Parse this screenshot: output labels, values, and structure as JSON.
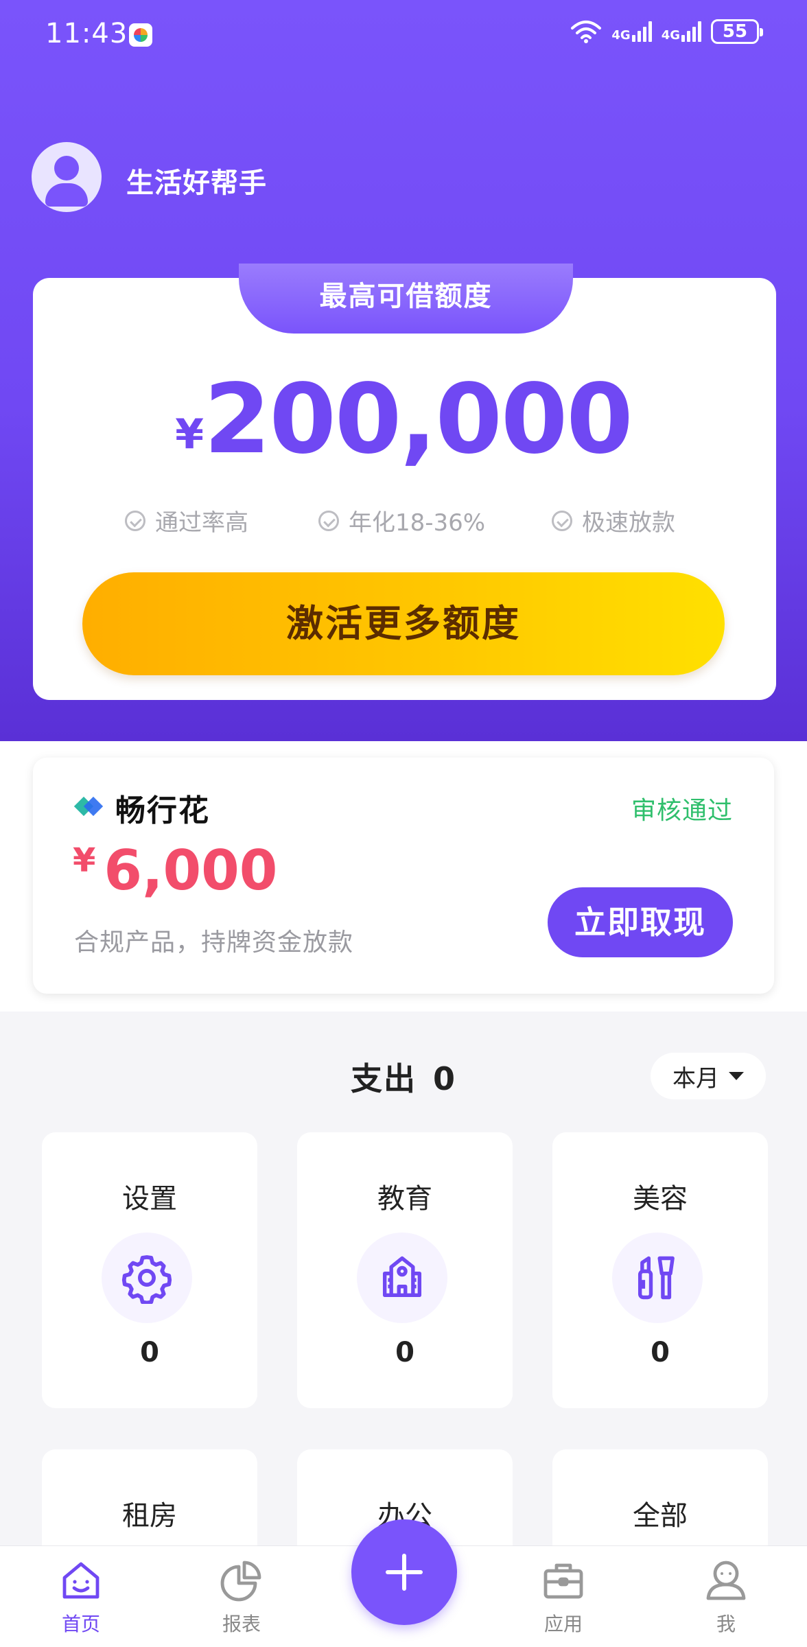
{
  "status_bar": {
    "time": "11:43",
    "signal1": "4G",
    "signal2": "4G",
    "battery": "55"
  },
  "header": {
    "app_name": "生活好帮手"
  },
  "quota": {
    "tab_label": "最高可借额度",
    "currency": "¥",
    "amount": "200,000",
    "features": [
      "通过率高",
      "年化18-36%",
      "极速放款"
    ],
    "activate_label": "激活更多额度"
  },
  "product": {
    "name": "畅行花",
    "status": "审核通过",
    "currency": "¥",
    "amount": "6,000",
    "description": "合规产品，持牌资金放款",
    "withdraw_label": "立即取现"
  },
  "expense": {
    "label": "支出",
    "value": "0",
    "period": "本月"
  },
  "categories": [
    {
      "label": "设置",
      "value": "0",
      "icon": "gear-icon"
    },
    {
      "label": "教育",
      "value": "0",
      "icon": "school-icon"
    },
    {
      "label": "美容",
      "value": "0",
      "icon": "cosmetics-icon"
    },
    {
      "label": "租房",
      "icon": "house-icon"
    },
    {
      "label": "办公",
      "icon": "office-icon"
    },
    {
      "label": "全部",
      "icon": "grid-icon"
    }
  ],
  "nav": [
    {
      "label": "首页",
      "icon": "home-icon",
      "active": true
    },
    {
      "label": "报表",
      "icon": "pie-chart-icon",
      "active": false
    },
    {
      "label": "应用",
      "icon": "briefcase-icon",
      "active": false
    },
    {
      "label": "我",
      "icon": "user-icon",
      "active": false
    }
  ],
  "colors": {
    "primary": "#7048f3",
    "accent_yellow": "#ffc700",
    "success": "#2fbf6c",
    "amount_red": "#f24d6b"
  }
}
